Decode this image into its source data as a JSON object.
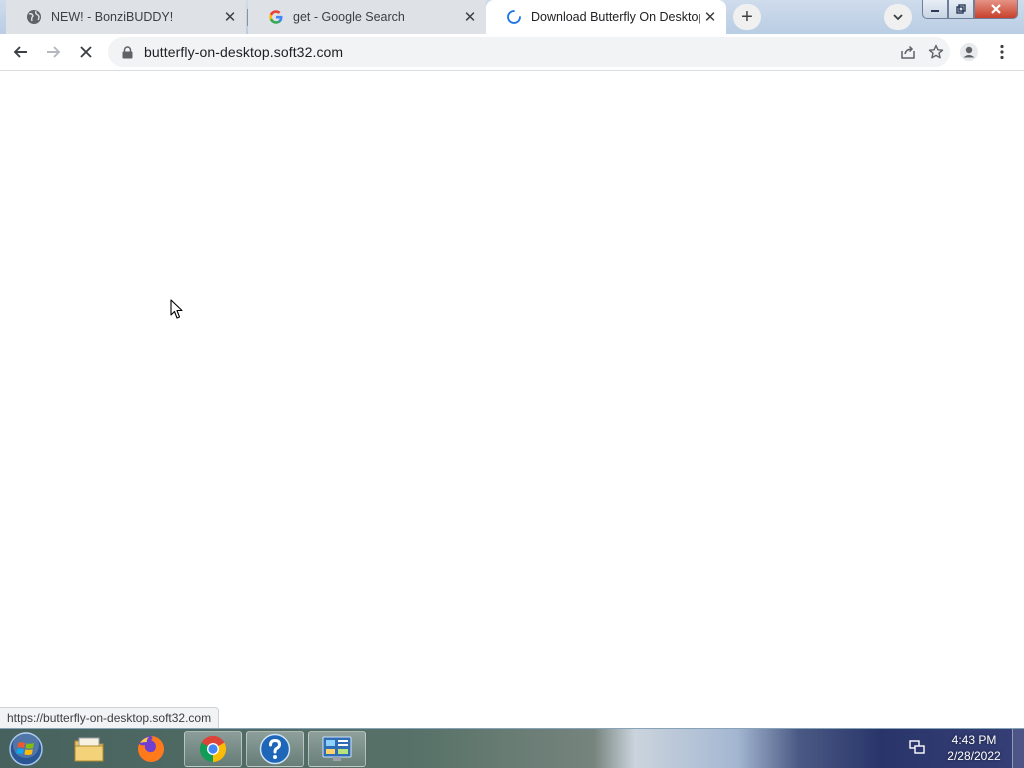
{
  "browser": {
    "tabs": [
      {
        "title": "NEW! - BonziBUDDY!",
        "favicon": "globe-icon",
        "active": false
      },
      {
        "title": "get - Google Search",
        "favicon": "google-g-icon",
        "active": false
      },
      {
        "title": "Download Butterfly On Desktop",
        "favicon": "loading-spinner-icon",
        "active": true
      }
    ],
    "omnibox": {
      "url": "butterfly-on-desktop.soft32.com",
      "security_icon": "lock-icon"
    },
    "toolbar_icons": [
      "back-arrow-icon",
      "forward-arrow-icon",
      "stop-loading-icon",
      "share-icon",
      "bookmark-star-icon",
      "profile-icon",
      "kebab-menu-icon"
    ],
    "status_url": "https://butterfly-on-desktop.soft32.com"
  },
  "taskbar": {
    "apps": [
      "file-explorer-icon",
      "firefox-icon",
      "chrome-icon",
      "help-icon",
      "control-panel-icon"
    ],
    "clock": {
      "time": "4:43 PM",
      "date": "2/28/2022"
    }
  },
  "colors": {
    "tab_inactive": "#dee1e6",
    "omnibox_bg": "#f1f3f4",
    "google_blue": "#4285f4",
    "taskbar_dark": "#2c3570"
  }
}
